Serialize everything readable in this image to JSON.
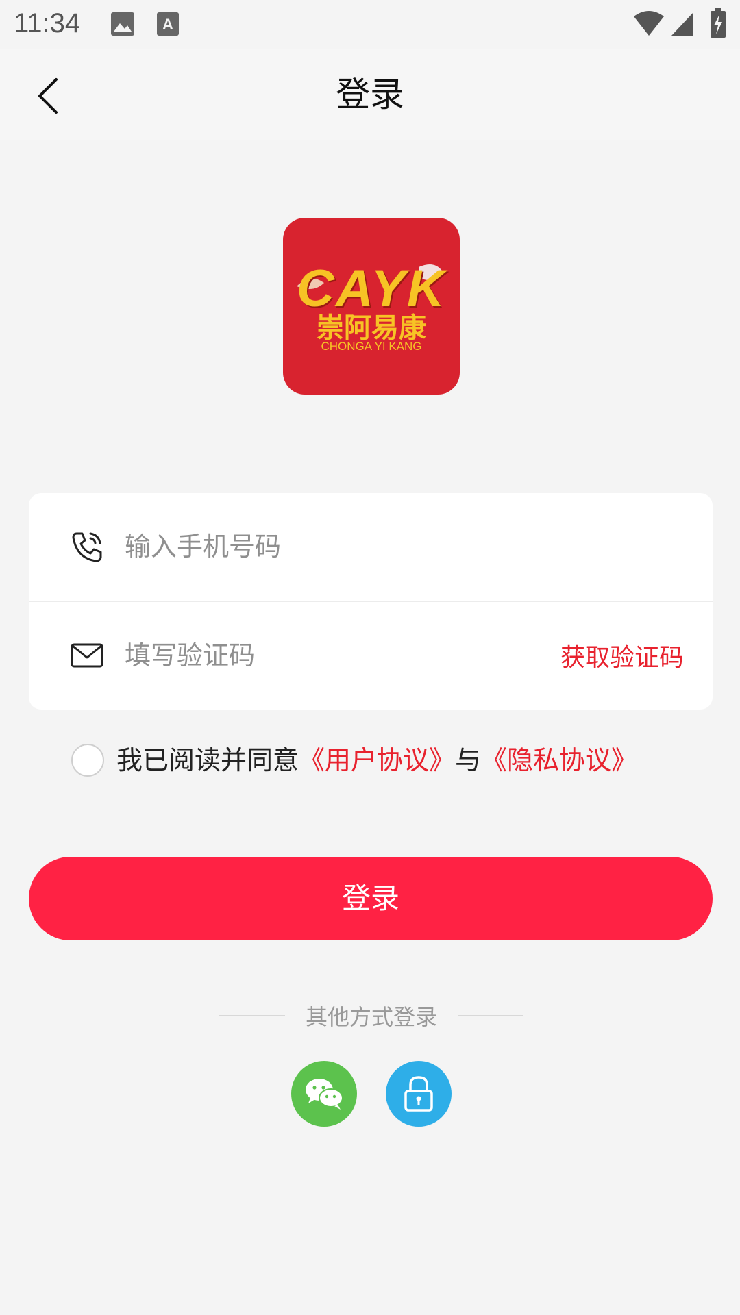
{
  "status_bar": {
    "time": "11:34",
    "icons": [
      "image-icon",
      "font-icon",
      "wifi-icon",
      "signal-icon",
      "battery-charging-icon"
    ]
  },
  "header": {
    "title": "登录",
    "back_icon": "chevron-left-icon"
  },
  "logo": {
    "latin": "CAYK",
    "chinese": "崇阿易康",
    "pinyin": "CHONGA YI KANG",
    "background": "#d8232f",
    "text_color": "#f7c325"
  },
  "form": {
    "phone": {
      "placeholder": "输入手机号码",
      "value": "",
      "icon": "phone-icon"
    },
    "code": {
      "placeholder": "填写验证码",
      "value": "",
      "icon": "mail-icon",
      "action_label": "获取验证码"
    }
  },
  "agreement": {
    "checked": false,
    "prefix": "我已阅读并同意",
    "user_agreement": "《用户协议》",
    "conjunction": "与",
    "privacy_agreement": "《隐私协议》"
  },
  "login_button": {
    "label": "登录"
  },
  "other_login": {
    "label": "其他方式登录",
    "options": [
      {
        "name": "wechat-icon",
        "color": "#5cc24d"
      },
      {
        "name": "lock-icon",
        "color": "#2eaee8"
      }
    ]
  },
  "colors": {
    "accent": "#ff2244",
    "link": "#e8222e",
    "background": "#f4f4f4"
  }
}
